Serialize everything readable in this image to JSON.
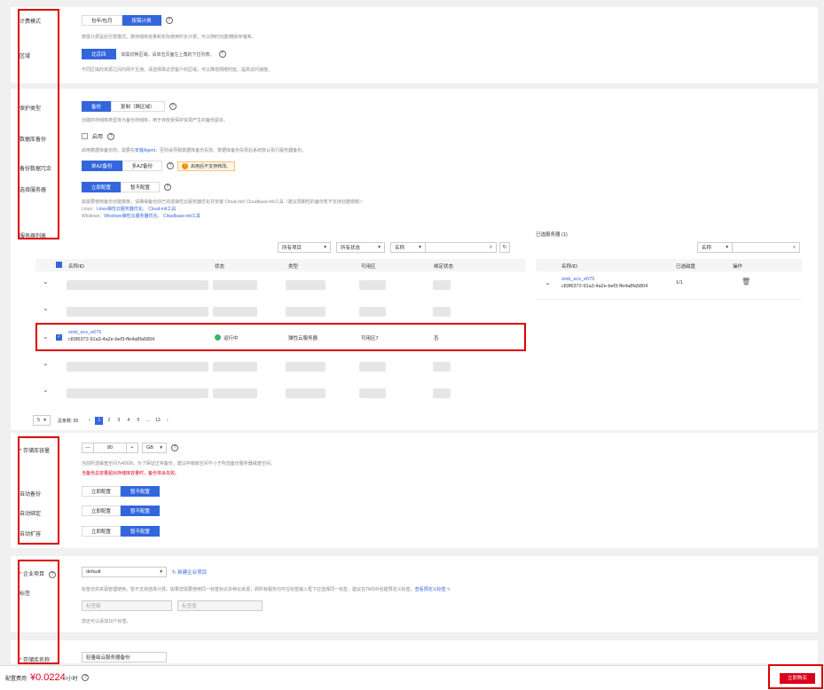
{
  "billing": {
    "label": "计费模式",
    "opt1": "包年/包月",
    "opt2": "按需计费",
    "hint": "按需计费是后付费模式，按存储库容量和实际使用时长计费，可以随时创建/删除存储库。"
  },
  "region": {
    "label": "区域",
    "value": "北京四",
    "note": "如需切换区域，请单击页面左上角的下拉列表。",
    "hint": "不同区域的资源之间内网不互通。请选择靠近您客户的区域，可以降低网络时延、提高访问速度。"
  },
  "protect": {
    "label": "保护类型",
    "opt1": "备份",
    "opt2": "复制（跨区域）",
    "hint": "创建的存储库类型将为备份存储库，用于存放受保护资源产生的备份副本。"
  },
  "dbbackup": {
    "label": "数据库备份",
    "check": "启用",
    "hint_pre": "启用数据库备份前，需要先",
    "hint_link": "安装Agent",
    "hint_post": "，否则会导致数据库备份失败。数据库备份失败后系统默认执行服务器备份。"
  },
  "redundancy": {
    "label": "备份数据冗余",
    "opt1": "单AZ备份",
    "opt2": "多AZ备份",
    "warn": "启用后不支持修改。"
  },
  "server": {
    "label": "选择服务器",
    "opt1": "立即配置",
    "opt2": "暂不配置",
    "hint": "如需要使用备份创建镜像，请确保备份前已完成弹性云服务器优化并安装 Cloud-Init/ Cloudbase-Init工具（建议周期性的备份暂不支持创建镜像）：",
    "linux_pre": "Linux：",
    "linux_link": "Linux弹性云服务器优化、 Cloud-init工具",
    "win_pre": "Windows：",
    "win_link": "Windows弹性云服务器优化、 Cloudbase-init工具"
  },
  "list": {
    "label": "服务器列表",
    "f1": "所有项目",
    "f2": "所有状态",
    "f3": "名称",
    "cols": [
      "名称/ID",
      "状态",
      "类型",
      "可用区",
      "绑定状态"
    ],
    "row": {
      "name": "smb_ecs_e675",
      "id": "c83f6372-91a3-4a2e-bef3-ffe4a8fa5804",
      "status": "运行中",
      "type": "弹性云服务器",
      "az": "可用区7",
      "bound": "否"
    },
    "pager": {
      "size": "5",
      "total": "总条数: 65",
      "pages": [
        "1",
        "2",
        "3",
        "4",
        "5",
        "...",
        "13"
      ]
    }
  },
  "selected": {
    "title": "已选服务器 (1)",
    "filter": "名称",
    "cols": [
      "名称/ID",
      "已选磁盘",
      "操作"
    ],
    "row": {
      "name": "smb_ecs_e675",
      "id": "c83f6372-91a3-4a2e-bef3-ffe4a8fa5804",
      "disks": "1/1"
    }
  },
  "capacity": {
    "label": "存储库容量",
    "value": "80",
    "unit": "GB",
    "hint": "当前所选磁盘空间为40GB。为了保证正常备份，建议存储库空间不小于所选备份服务器磁盘空间。",
    "warn": "当备份总容量超出存储库容量时，备份将会失败。"
  },
  "autobackup": {
    "label": "自动备份",
    "opt1": "立即配置",
    "opt2": "暂不配置"
  },
  "autobind": {
    "label": "自动绑定",
    "opt1": "立即配置",
    "opt2": "暂不配置"
  },
  "autoexpand": {
    "label": "自动扩容",
    "opt1": "立即配置",
    "opt2": "暂不配置"
  },
  "enterprise": {
    "label": "企业项目",
    "value": "default",
    "new": "新建企业项目"
  },
  "tags": {
    "label": "标签",
    "hint": "标签仅供资源管理使用，暂不支持选择计费。如果您需要使用同一标签标识多种云资源，即所有服务均可在标签输入框下拉选择同一标签，建议在TMS中创建预定义标签。",
    "hint_link": "查看预定义标签",
    "key_ph": "标签键",
    "val_ph": "标签值",
    "count": "您还可以添加10个标签。"
  },
  "name": {
    "label": "存储库名称",
    "value": "轻量级云服务器备份"
  },
  "footer": {
    "fee_label": "配置费用",
    "fee": "¥0.0224",
    "fee_unit": "/小时",
    "buy": "立即购买"
  }
}
